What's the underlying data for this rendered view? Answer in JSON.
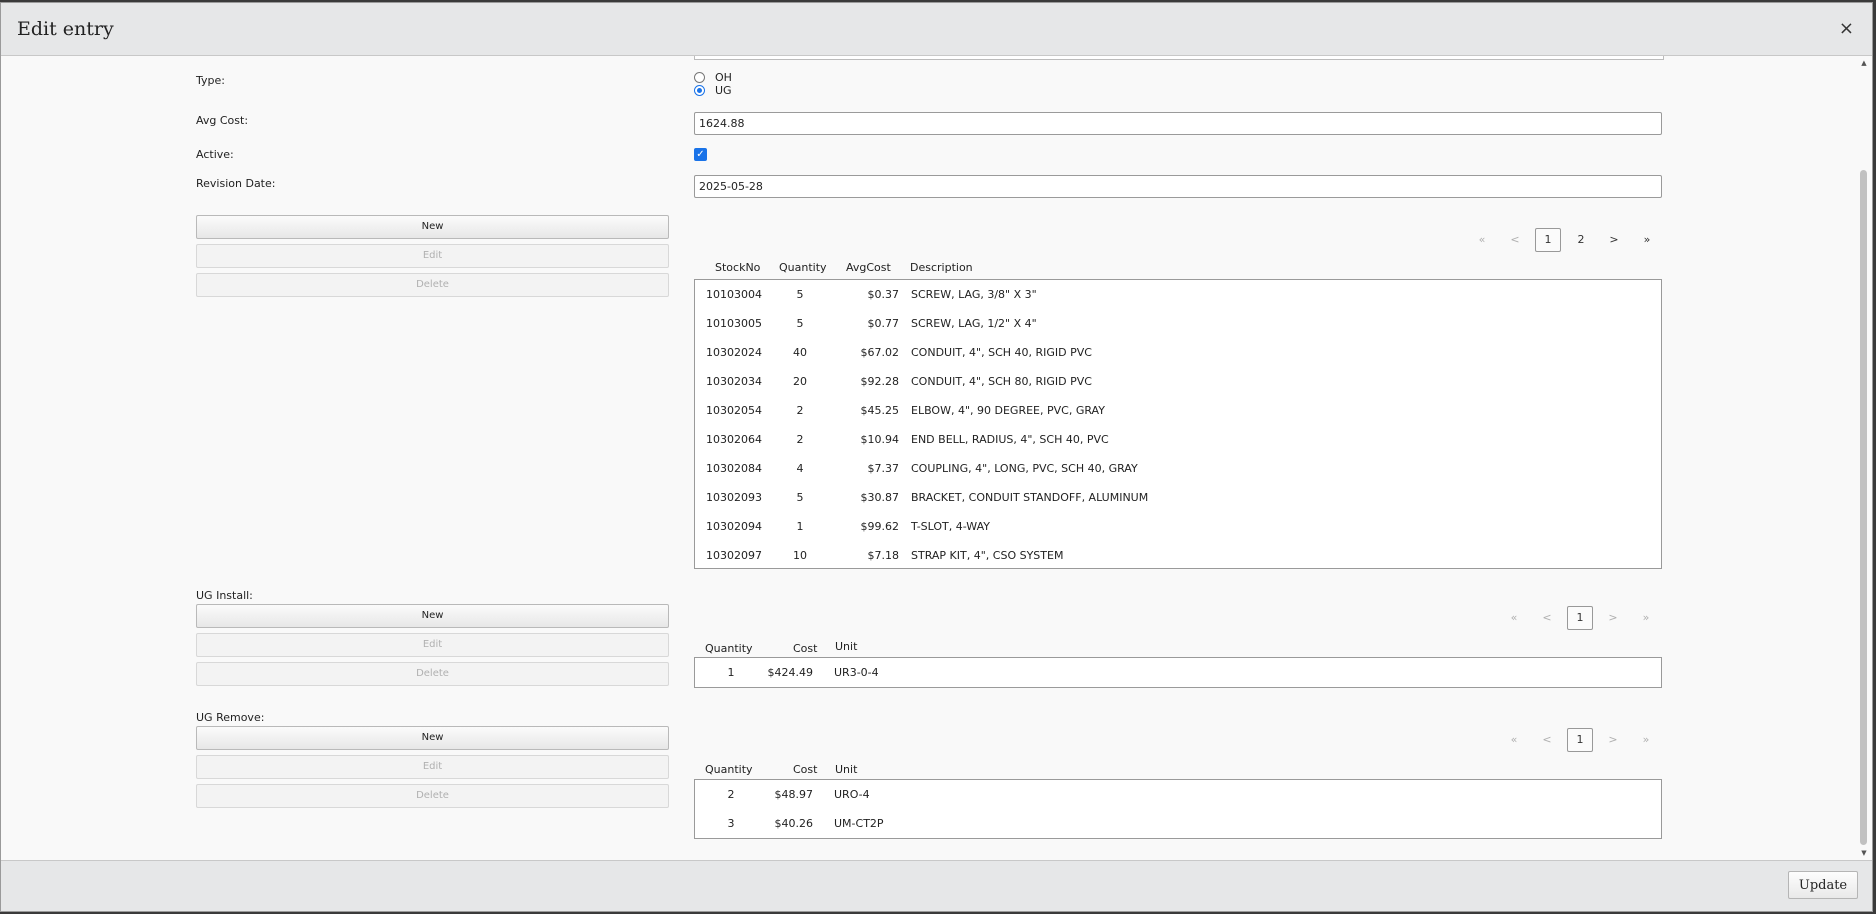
{
  "dialog": {
    "title": "Edit entry",
    "close_glyph": "×",
    "update_label": "Update"
  },
  "form": {
    "type_label": "Type:",
    "type_options": [
      "OH",
      "UG"
    ],
    "type_selected": "UG",
    "avg_cost_label": "Avg Cost:",
    "avg_cost_value": "1624.88",
    "active_label": "Active:",
    "active_checked": true,
    "revision_label": "Revision Date:",
    "revision_value": "2025-05-28"
  },
  "buttons": {
    "new": "New",
    "edit": "Edit",
    "delete": "Delete"
  },
  "pager": {
    "first": "«",
    "prev": "<",
    "next": ">",
    "last": "»"
  },
  "materials": {
    "pages": [
      "1",
      "2"
    ],
    "current_page": "1",
    "headers": [
      "StockNo",
      "Quantity",
      "AvgCost",
      "Description"
    ],
    "rows": [
      {
        "stock": "10103004",
        "qty": "5",
        "cost": "$0.37",
        "desc": "SCREW, LAG, 3/8\" X 3\""
      },
      {
        "stock": "10103005",
        "qty": "5",
        "cost": "$0.77",
        "desc": "SCREW, LAG, 1/2\" X 4\""
      },
      {
        "stock": "10302024",
        "qty": "40",
        "cost": "$67.02",
        "desc": "CONDUIT, 4\", SCH 40, RIGID PVC"
      },
      {
        "stock": "10302034",
        "qty": "20",
        "cost": "$92.28",
        "desc": "CONDUIT, 4\", SCH 80, RIGID PVC"
      },
      {
        "stock": "10302054",
        "qty": "2",
        "cost": "$45.25",
        "desc": "ELBOW, 4\", 90 DEGREE, PVC, GRAY"
      },
      {
        "stock": "10302064",
        "qty": "2",
        "cost": "$10.94",
        "desc": "END BELL, RADIUS, 4\", SCH 40, PVC"
      },
      {
        "stock": "10302084",
        "qty": "4",
        "cost": "$7.37",
        "desc": "COUPLING, 4\", LONG, PVC, SCH 40, GRAY"
      },
      {
        "stock": "10302093",
        "qty": "5",
        "cost": "$30.87",
        "desc": "BRACKET, CONDUIT STANDOFF, ALUMINUM"
      },
      {
        "stock": "10302094",
        "qty": "1",
        "cost": "$99.62",
        "desc": "T-SLOT, 4-WAY"
      },
      {
        "stock": "10302097",
        "qty": "10",
        "cost": "$7.18",
        "desc": "STRAP KIT, 4\", CSO SYSTEM"
      }
    ]
  },
  "ug_install": {
    "label": "UG Install:",
    "current_page": "1",
    "headers": [
      "Quantity",
      "Cost",
      "Unit"
    ],
    "rows": [
      {
        "qty": "1",
        "cost": "$424.49",
        "unit": "UR3-0-4"
      }
    ]
  },
  "ug_remove": {
    "label": "UG Remove:",
    "current_page": "1",
    "headers": [
      "Quantity",
      "Cost",
      "Unit"
    ],
    "rows": [
      {
        "qty": "2",
        "cost": "$48.97",
        "unit": "URO-4"
      },
      {
        "qty": "3",
        "cost": "$40.26",
        "unit": "UM-CT2P"
      }
    ]
  },
  "colors": {
    "accent": "#1a73e8",
    "header_bg": "#e6e7e8",
    "body_bg": "#f9f9f9"
  }
}
